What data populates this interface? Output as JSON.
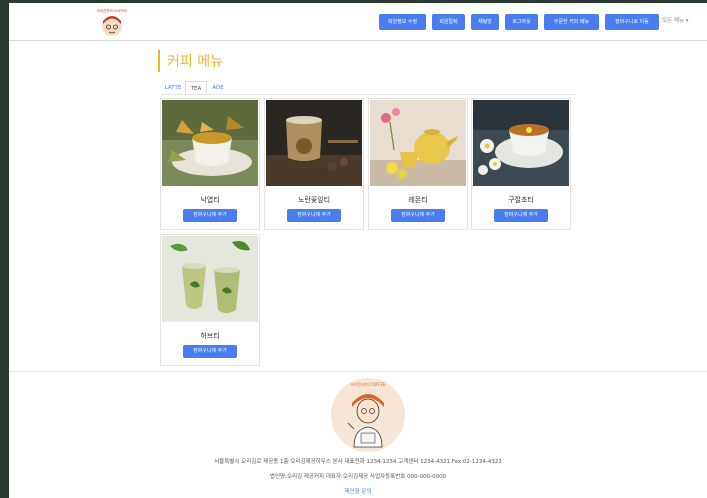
{
  "header": {
    "logo_text": "오리진커피 COFFEE",
    "nav": [
      {
        "label": "회원정보 수정"
      },
      {
        "label": "회원탈퇴"
      },
      {
        "label": "채팅방"
      },
      {
        "label": "로그아웃"
      },
      {
        "label": "주문한 커피 메뉴"
      },
      {
        "label": "장바구니로 이동"
      }
    ],
    "more": "모든 메뉴 ▾"
  },
  "main": {
    "title": "커피 메뉴",
    "tabs": [
      {
        "label": "LATTE",
        "active": false
      },
      {
        "label": "TEA",
        "active": true
      },
      {
        "label": "ADE",
        "active": false
      }
    ],
    "cards": [
      {
        "name": "낙엽티",
        "button": "장바구니에 추가"
      },
      {
        "name": "노란꽃잎티",
        "button": "장바구니에 추가"
      },
      {
        "name": "레몬티",
        "button": "장바구니에 추가"
      },
      {
        "name": "구절초티",
        "button": "장바구니에 추가"
      },
      {
        "name": "허브티",
        "button": "장바구니에 추가"
      }
    ]
  },
  "footer": {
    "logo_text": "오리진커피 COFFEE",
    "address": "서울특별시 오리김로 제공동 1층 오리김제공하우스 본사 대표전화 1234-1234 고객센터 1234-4321 Fax 02-1234-4321",
    "company": "법인명:오리김 제공커피 대표자:오리김제공 사업자등록번호 000-000-0000",
    "link": "제안형 문의"
  },
  "colors": {
    "accent": "#4a7df0",
    "title": "#f0b429"
  }
}
